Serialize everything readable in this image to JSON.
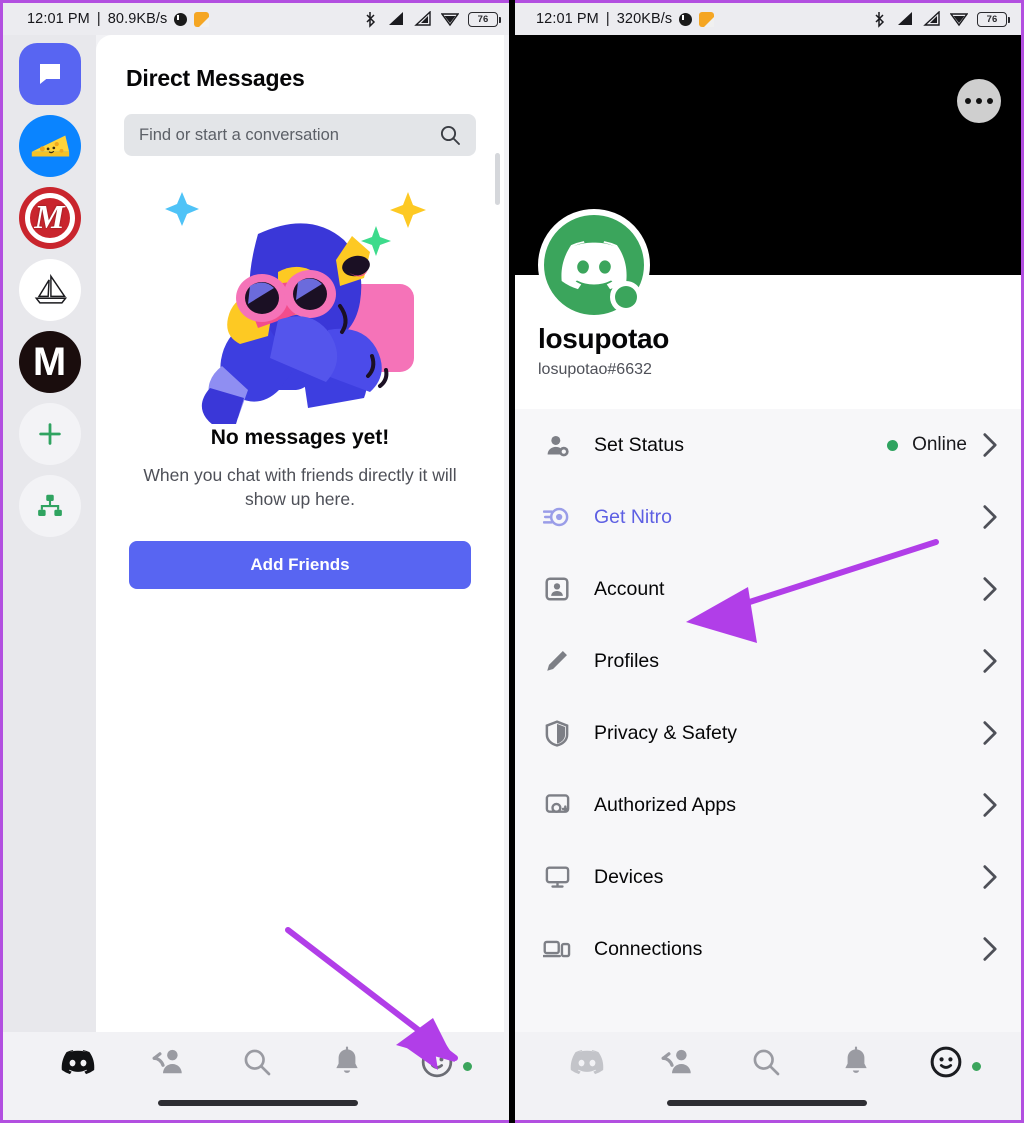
{
  "accent": {
    "arrow_purple": "#b13ee8",
    "blurple": "#5865f2",
    "nitro": "#5d5fe3",
    "online_green": "#3ba55c",
    "frame_border": "#b24fe0"
  },
  "left_phone": {
    "statusbar": {
      "time": "12:01 PM",
      "separator": "|",
      "network_speed": "80.9KB/s",
      "battery": "76",
      "icons": [
        "mute-icon",
        "note-icon",
        "bluetooth-icon",
        "signal-1-icon",
        "signal-2-icon",
        "wifi-icon",
        "battery-icon"
      ]
    },
    "server_rail": {
      "items": [
        {
          "name": "direct-messages",
          "label": "",
          "icon": "speech-bubble-icon",
          "selected": true
        },
        {
          "name": "cheese-server",
          "label": "",
          "icon": "cheese-icon",
          "selected": false
        },
        {
          "name": "m-red-server",
          "label": "M",
          "icon": "server-avatar",
          "selected": false
        },
        {
          "name": "sailboat-server",
          "label": "",
          "icon": "sailboat-icon",
          "selected": false
        },
        {
          "name": "m-dark-server",
          "label": "M",
          "icon": "server-avatar",
          "selected": false
        },
        {
          "name": "add-server",
          "label": "+",
          "icon": "plus-icon",
          "selected": false
        },
        {
          "name": "explore-servers",
          "label": "",
          "icon": "compass-tree-icon",
          "selected": false
        }
      ]
    },
    "dm": {
      "title": "Direct Messages",
      "search_placeholder": "Find or start a conversation",
      "empty_heading": "No messages yet!",
      "empty_body": "When you chat with friends directly it will show up here.",
      "add_friends_label": "Add Friends"
    },
    "bottom_nav": [
      {
        "name": "nav-servers",
        "icon": "discord-icon",
        "active": true
      },
      {
        "name": "nav-friends",
        "icon": "friends-icon",
        "active": false
      },
      {
        "name": "nav-search",
        "icon": "search-icon",
        "active": false
      },
      {
        "name": "nav-notifications",
        "icon": "bell-icon",
        "active": false
      },
      {
        "name": "nav-profile",
        "icon": "user-avatar-icon",
        "active": false
      }
    ]
  },
  "right_phone": {
    "statusbar": {
      "time": "12:01 PM",
      "separator": "|",
      "network_speed": "320KB/s",
      "battery": "76"
    },
    "profile": {
      "username": "losupotao",
      "tag": "losupotao#6632",
      "avatar_icon": "discord-avatar-icon",
      "more_icon": "more-horizontal-icon"
    },
    "settings_rows": [
      {
        "name": "set-status",
        "icon": "person-status-icon",
        "label": "Set Status",
        "value": "Online",
        "has_dot": true,
        "nitro": false
      },
      {
        "name": "get-nitro",
        "icon": "nitro-boost-icon",
        "label": "Get Nitro",
        "value": "",
        "has_dot": false,
        "nitro": true
      },
      {
        "name": "account",
        "icon": "id-card-icon",
        "label": "Account",
        "value": "",
        "has_dot": false,
        "nitro": false
      },
      {
        "name": "profiles",
        "icon": "pencil-icon",
        "label": "Profiles",
        "value": "",
        "has_dot": false,
        "nitro": false
      },
      {
        "name": "privacy-safety",
        "icon": "shield-icon",
        "label": "Privacy & Safety",
        "value": "",
        "has_dot": false,
        "nitro": false
      },
      {
        "name": "authorized-apps",
        "icon": "apps-icon",
        "label": "Authorized Apps",
        "value": "",
        "has_dot": false,
        "nitro": false
      },
      {
        "name": "devices",
        "icon": "monitor-icon",
        "label": "Devices",
        "value": "",
        "has_dot": false,
        "nitro": false
      },
      {
        "name": "connections",
        "icon": "laptop-phone-icon",
        "label": "Connections",
        "value": "",
        "has_dot": false,
        "nitro": false
      }
    ],
    "bottom_nav": [
      {
        "name": "nav-servers",
        "icon": "discord-icon",
        "active": false
      },
      {
        "name": "nav-friends",
        "icon": "friends-icon",
        "active": false
      },
      {
        "name": "nav-search",
        "icon": "search-icon",
        "active": false
      },
      {
        "name": "nav-notifications",
        "icon": "bell-icon",
        "active": false
      },
      {
        "name": "nav-profile",
        "icon": "user-avatar-icon",
        "active": true
      }
    ]
  },
  "annotations": [
    {
      "name": "arrow-to-profile-tab",
      "color": "#b13ee8"
    },
    {
      "name": "arrow-to-account-row",
      "color": "#b13ee8"
    }
  ]
}
